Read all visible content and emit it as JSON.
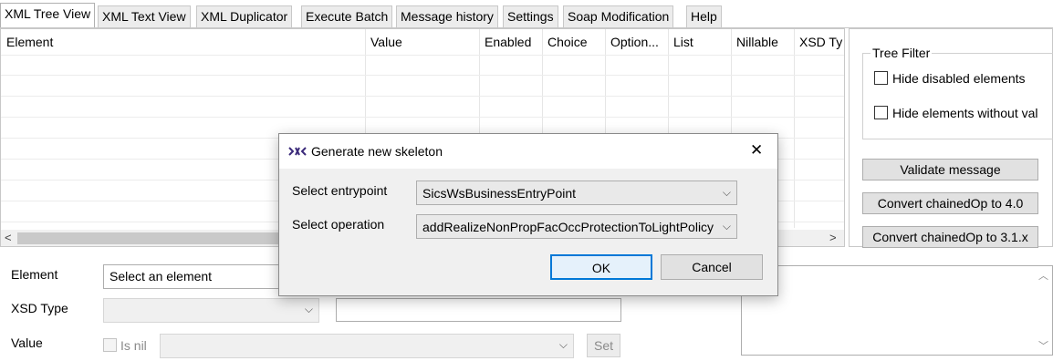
{
  "tabs": [
    {
      "label": "XML Tree View",
      "active": true
    },
    {
      "label": "XML Text View",
      "active": false
    },
    {
      "label": "XML Duplicator",
      "active": false
    },
    {
      "label": "Execute Batch",
      "active": false
    },
    {
      "label": "Message history",
      "active": false
    },
    {
      "label": "Settings",
      "active": false
    },
    {
      "label": "Soap Modification",
      "active": false
    },
    {
      "label": "Help",
      "active": false
    }
  ],
  "tree": {
    "columns": [
      "Element",
      "Value",
      "Enabled",
      "Choice",
      "Option...",
      "List",
      "Nillable",
      "XSD Ty"
    ]
  },
  "tree_filter": {
    "title": "Tree Filter",
    "hide_disabled_label": "Hide disabled elements",
    "hide_without_value_label": "Hide elements without val",
    "hide_disabled_checked": false,
    "hide_without_value_checked": false
  },
  "actions": {
    "validate_label": "Validate message",
    "convert_40_label": "Convert chainedOp to 4.0",
    "convert_31x_label": "Convert chainedOp to 3.1.x"
  },
  "editor": {
    "element_label": "Element",
    "element_value": "Select an element",
    "xsd_type_label": "XSD Type",
    "xsd_type_value": "",
    "value_label": "Value",
    "is_nil_label": "Is nil",
    "value_value": "",
    "set_label": "Set"
  },
  "dialog": {
    "title": "Generate new skeleton",
    "close_glyph": "✕",
    "entrypoint_label": "Select entrypoint",
    "entrypoint_value": "SicsWsBusinessEntryPoint",
    "operation_label": "Select operation",
    "operation_value": "addRealizeNonPropFacOccProtectionToLightPolicy",
    "ok_label": "OK",
    "cancel_label": "Cancel"
  },
  "icons": {
    "app": "app-logo-icon",
    "chevron": "chevron-down-icon",
    "scroll_left": "scroll-left-icon",
    "scroll_right": "scroll-right-icon"
  }
}
